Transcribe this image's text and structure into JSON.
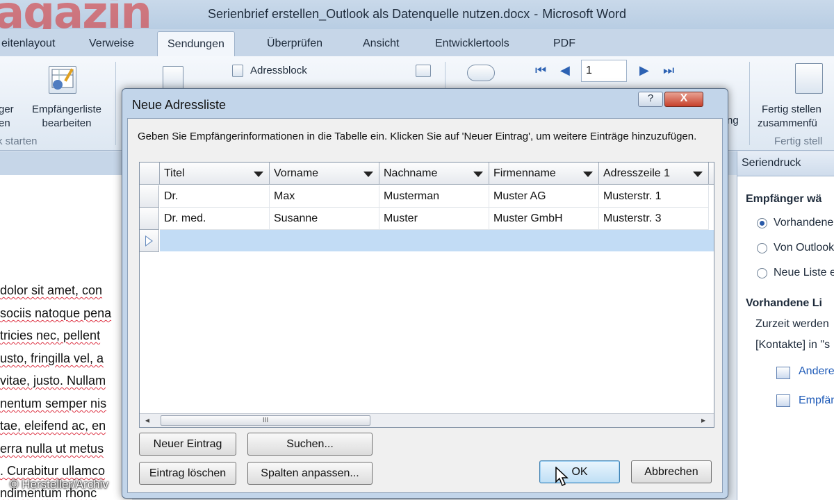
{
  "window": {
    "brand_fragment": "agazin",
    "doc_title": "Serienbrief erstellen_Outlook als Datenquelle nutzen.docx",
    "separator": "-",
    "app_title": "Microsoft Word"
  },
  "tabs": [
    "eitenlayout",
    "Verweise",
    "Sendungen",
    "Überprüfen",
    "Ansicht",
    "Entwicklertools",
    "PDF"
  ],
  "ribbon": {
    "partial_btn_line1": "ger",
    "partial_btn_line2": "en",
    "edit_recipients_line1": "Empfängerliste",
    "edit_recipients_line2": "bearbeiten",
    "group_start": "k starten",
    "address_block": "Adressblock",
    "page_number": "1",
    "partial_right": "ng",
    "finish_line1": "Fertig stellen",
    "finish_line2": "zusammenfü",
    "group_finish": "Fertig stell"
  },
  "document": {
    "lines": [
      "dolor sit amet, con",
      "sociis natoque pena",
      "tricies nec, pellent",
      "usto, fringilla vel, a",
      "vitae, justo. Nullam",
      "nentum semper nis",
      "tae, eleifend ac, en",
      "erra nulla ut metus",
      ". Curabitur ullamco",
      "ndimentum rhonc"
    ]
  },
  "pane": {
    "title": "Seriendruck",
    "section1": "Empfänger wä",
    "radio1": "Vorhandene",
    "radio2": "Von Outlook",
    "radio3": "Neue Liste e",
    "section2": "Vorhandene Li",
    "text1": "Zurzeit werden",
    "text2": "[Kontakte] in \"s",
    "link1": "Andere",
    "link2": "Empfän"
  },
  "dialog": {
    "title": "Neue Adressliste",
    "help": "?",
    "close": "X",
    "instructions": "Geben Sie Empfängerinformationen in die Tabelle ein. Klicken Sie auf 'Neuer Eintrag', um weitere Einträge hinzuzufügen.",
    "columns": [
      "Titel",
      "Vorname",
      "Nachname",
      "Firmenname",
      "Adresszeile 1"
    ],
    "rows": [
      [
        "Dr.",
        "Max",
        "Musterman",
        "Muster AG",
        "Musterstr. 1"
      ],
      [
        "Dr. med.",
        "Susanne",
        "Muster",
        "Muster GmbH",
        "Musterstr. 3"
      ]
    ],
    "scroll_thumb": "III",
    "buttons": {
      "new_entry": "Neuer Eintrag",
      "search": "Suchen...",
      "delete_entry": "Eintrag löschen",
      "customize_columns": "Spalten anpassen...",
      "ok": "OK",
      "cancel": "Abbrechen"
    }
  },
  "credit": "© Hersteller/Archiv"
}
